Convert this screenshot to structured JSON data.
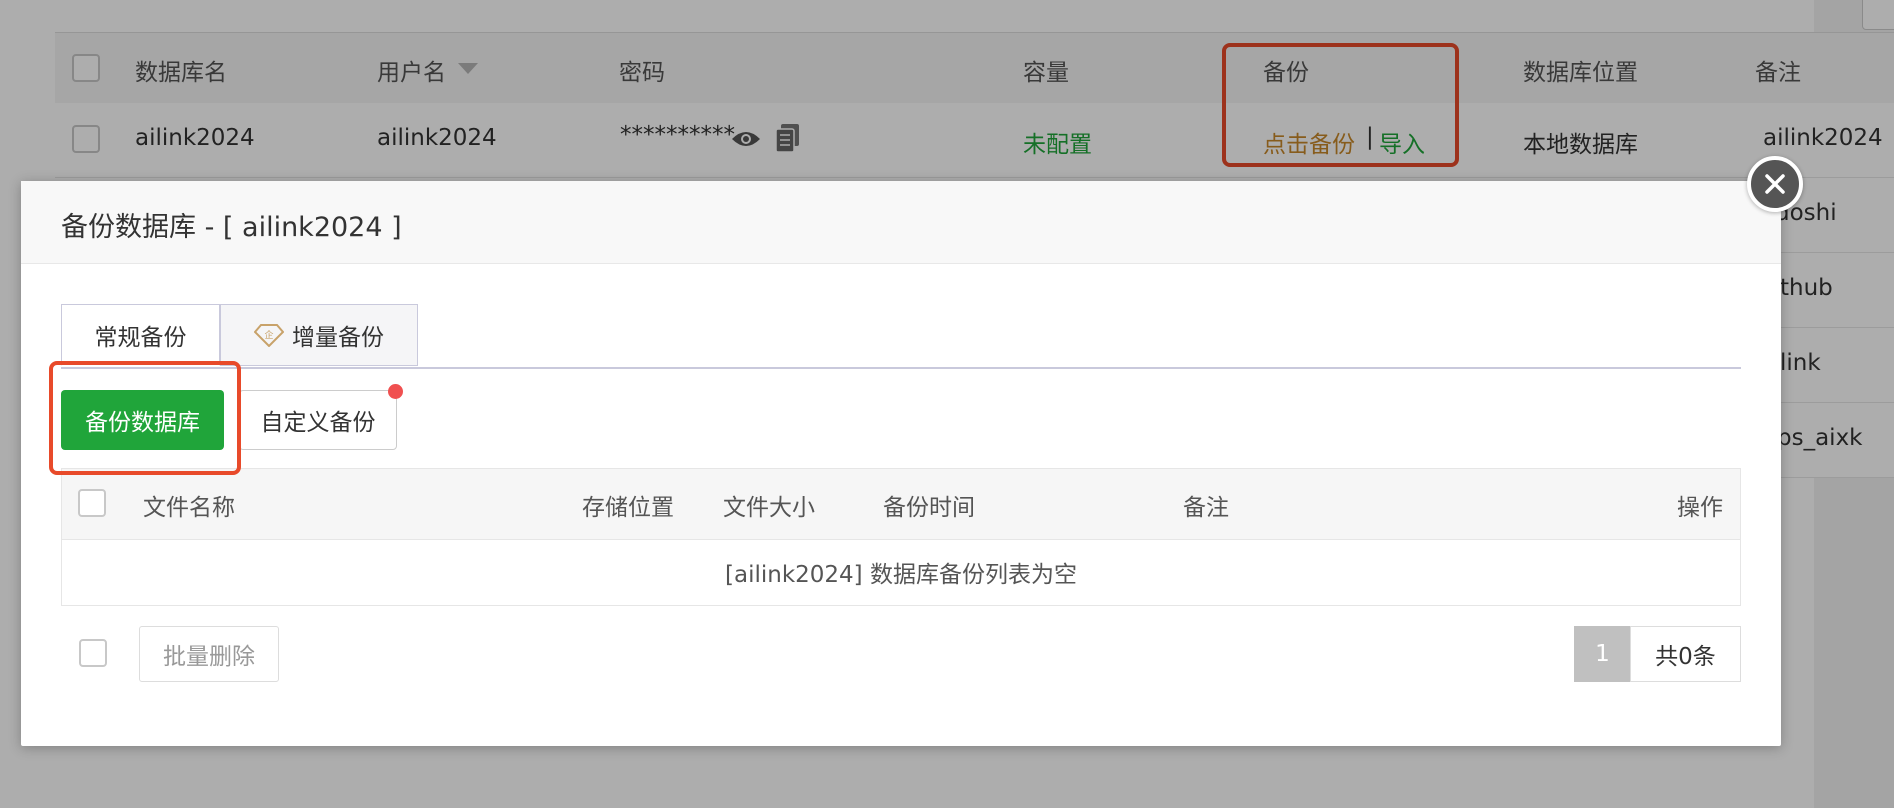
{
  "background_table": {
    "headers": [
      "数据库名",
      "用户名",
      "密码",
      "容量",
      "备份",
      "数据库位置",
      "备注"
    ],
    "row": {
      "db_name": "ailink2024",
      "username": "ailink2024",
      "password_mask": "**********",
      "capacity": "未配置",
      "backup_link": "点击备份",
      "separator": "|",
      "import_link": "导入",
      "location": "本地数据库",
      "remark": "ailink2024"
    },
    "partial_remarks": [
      "doshi",
      "thub",
      "link",
      "ps_aixk"
    ]
  },
  "modal": {
    "title": "备份数据库 - [ ailink2024 ]",
    "tabs": [
      "常规备份",
      "增量备份"
    ],
    "backup_button": "备份数据库",
    "custom_backup_button": "自定义备份",
    "columns": [
      "文件名称",
      "存储位置",
      "文件大小",
      "备份时间",
      "备注",
      "操作"
    ],
    "empty_message": "[ailink2024] 数据库备份列表为空",
    "batch_delete_button": "批量删除",
    "pagination": {
      "current_page": "1",
      "total": "共0条"
    }
  },
  "colors": {
    "brand_green": "#20a53a",
    "highlight_red": "#e84a2a",
    "backup_link": "#c8882a",
    "notification_dot": "#f05050"
  },
  "icons": [
    "eye-icon",
    "copy-icon",
    "sort-caret-icon",
    "close-icon",
    "enterprise-diamond-icon"
  ]
}
